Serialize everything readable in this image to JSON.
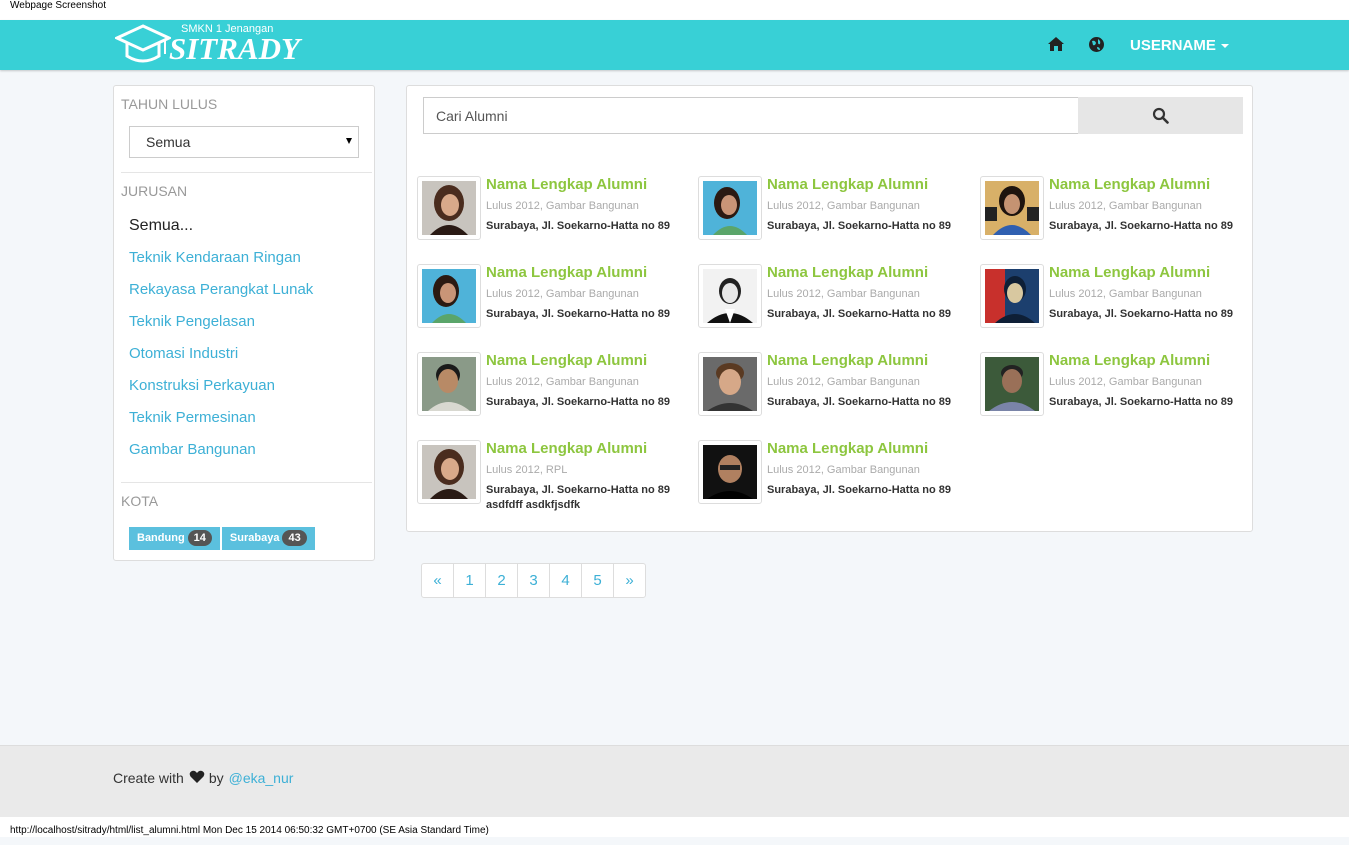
{
  "window": {
    "caption_top": "Webpage Screenshot",
    "caption_bottom": "http://localhost/sitrady/html/list_alumni.html Mon Dec 15 2014 06:50:32 GMT+0700 (SE Asia Standard Time)"
  },
  "navbar": {
    "brand_small": "SMKN 1 Jenangan",
    "brand_name": "SITRADY",
    "home_icon": "home-icon",
    "globe_icon": "globe-icon",
    "username": "USERNAME",
    "accent_color": "#38d0d6"
  },
  "sidebar": {
    "tahun_heading": "TAHUN LULUS",
    "tahun_selected": "Semua",
    "jurusan_heading": "JURUSAN",
    "jurusan_items": [
      "Semua...",
      "Teknik Kendaraan Ringan",
      "Rekayasa Perangkat Lunak",
      "Teknik Pengelasan",
      "Otomasi Industri",
      "Konstruksi Perkayuan",
      "Teknik Permesinan",
      "Gambar Bangunan"
    ],
    "kota_heading": "KOTA",
    "kota": [
      {
        "name": "Bandung",
        "count": "14"
      },
      {
        "name": "Surabaya",
        "count": "43"
      }
    ]
  },
  "search": {
    "placeholder": "Cari Alumni",
    "icon": "search-icon"
  },
  "alumni": [
    {
      "name": "Nama Lengkap Alumni",
      "meta": "Lulus 2012, Gambar Bangunan",
      "address": "Surabaya, Jl. Soekarno-Hatta no 89"
    },
    {
      "name": "Nama Lengkap Alumni",
      "meta": "Lulus 2012, Gambar Bangunan",
      "address": "Surabaya, Jl. Soekarno-Hatta no 89"
    },
    {
      "name": "Nama Lengkap Alumni",
      "meta": "Lulus 2012, Gambar Bangunan",
      "address": "Surabaya, Jl. Soekarno-Hatta no 89"
    },
    {
      "name": "Nama Lengkap Alumni",
      "meta": "Lulus 2012, Gambar Bangunan",
      "address": "Surabaya, Jl. Soekarno-Hatta no 89"
    },
    {
      "name": "Nama Lengkap Alumni",
      "meta": "Lulus 2012, Gambar Bangunan",
      "address": "Surabaya, Jl. Soekarno-Hatta no 89"
    },
    {
      "name": "Nama Lengkap Alumni",
      "meta": "Lulus 2012, Gambar Bangunan",
      "address": "Surabaya, Jl. Soekarno-Hatta no 89"
    },
    {
      "name": "Nama Lengkap Alumni",
      "meta": "Lulus 2012, Gambar Bangunan",
      "address": "Surabaya, Jl. Soekarno-Hatta no 89"
    },
    {
      "name": "Nama Lengkap Alumni",
      "meta": "Lulus 2012, Gambar Bangunan",
      "address": "Surabaya, Jl. Soekarno-Hatta no 89"
    },
    {
      "name": "Nama Lengkap Alumni",
      "meta": "Lulus 2012, Gambar Bangunan",
      "address": "Surabaya, Jl. Soekarno-Hatta no 89"
    },
    {
      "name": "Nama Lengkap Alumni",
      "meta": "Lulus 2012, RPL",
      "address": "Surabaya, Jl. Soekarno-Hatta no 89 asdfdff asdkfjsdfk"
    },
    {
      "name": "Nama Lengkap Alumni",
      "meta": "Lulus 2012, Gambar Bangunan",
      "address": "Surabaya, Jl. Soekarno-Hatta no 89"
    }
  ],
  "pagination": {
    "prev": "«",
    "pages": [
      "1",
      "2",
      "3",
      "4",
      "5"
    ],
    "next": "»"
  },
  "footer": {
    "text": "Create with",
    "heart_icon": "heart-icon",
    "by": "by",
    "link": "@eka_nur"
  }
}
